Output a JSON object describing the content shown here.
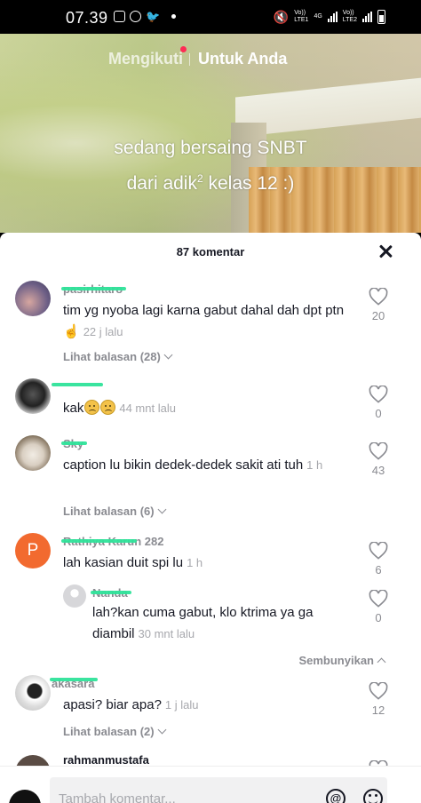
{
  "status_bar": {
    "time": "07.39",
    "sim1": "Vo))\nLTE1",
    "net": "4G",
    "sim2": "Vo))\nLTE2"
  },
  "top_nav": {
    "following": "Mengikuti",
    "for_you": "Untuk Anda"
  },
  "video": {
    "caption_line1": "sedang bersaing SNBT",
    "caption_line2_pre": "dari adik",
    "caption_sup": "2",
    "caption_line2_post": " kelas 12 :)"
  },
  "sheet": {
    "title": "87 komentar"
  },
  "comments": [
    {
      "username": "pasirhitaro",
      "text": "tim yg nyoba lagi karna gabut dahal dah dpt ptn ☝️",
      "time": "22 j lalu",
      "replies": "Lihat balasan (28)",
      "likes": "20"
    },
    {
      "username": "",
      "text": "kak",
      "time": "44 mnt lalu",
      "likes": "0"
    },
    {
      "username": "Sky",
      "text": "caption lu bikin dedek-dedek sakit ati tuh",
      "time": "1 h",
      "replies": "Lihat balasan (6)",
      "likes": "43"
    },
    {
      "username": "Rathiya Karun 282",
      "avatar_letter": "P",
      "text": "lah kasian duit spi lu",
      "time": "1 h",
      "likes": "6"
    },
    {
      "username": "Nanda",
      "text": "lah?kan cuma gabut, klo ktrima ya ga diambil",
      "time": "30 mnt lalu",
      "likes": "0",
      "hide": "Sembunyikan"
    },
    {
      "username": "akasara",
      "text": "apasi? biar apa?",
      "time": "1 j lalu",
      "replies": "Lihat balasan (2)",
      "likes": "12"
    },
    {
      "username": "rahmanmustafa"
    }
  ],
  "input": {
    "placeholder": "Tambah komentar..."
  },
  "colors": {
    "accent": "#fe2c55",
    "redact": "#2fe39a",
    "avatar_orange": "#f26a2f"
  },
  "icons": [
    "mute-icon",
    "heart-icon",
    "close-icon",
    "at-icon",
    "emoji-icon",
    "chevron-down-icon",
    "chevron-up-icon"
  ]
}
